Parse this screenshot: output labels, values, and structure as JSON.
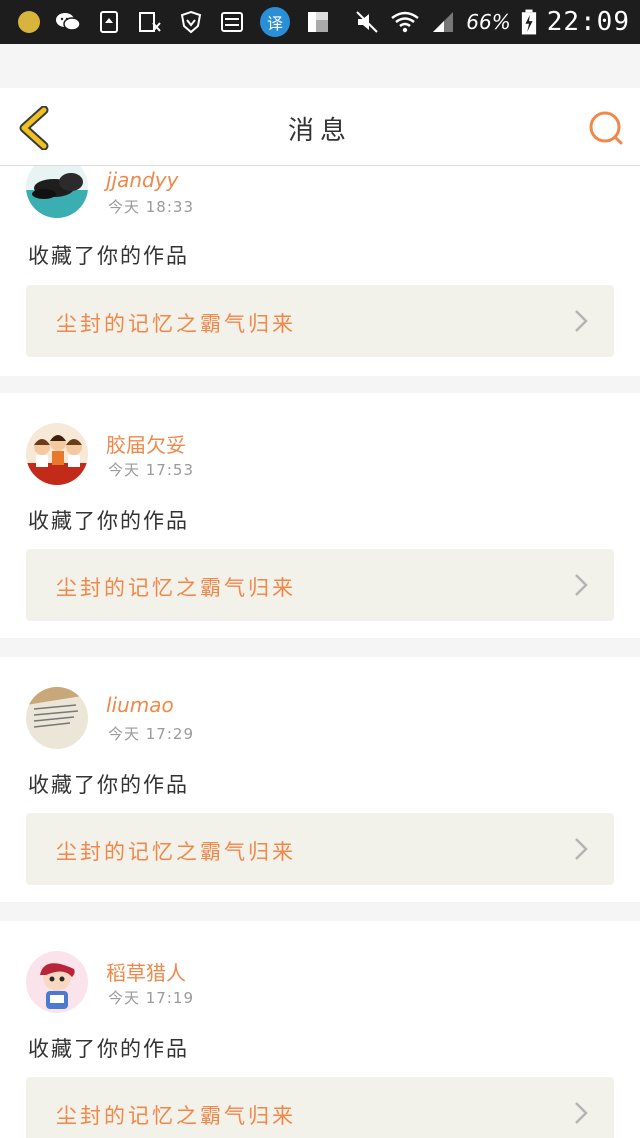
{
  "status_bar": {
    "battery": "66%",
    "time": "22:09",
    "translate_badge": "译"
  },
  "header": {
    "title": "消息"
  },
  "messages": [
    {
      "user": "jjandyy",
      "time": "今天 18:33",
      "action": "收藏了你的作品",
      "work": "尘封的记忆之霸气归来"
    },
    {
      "user": "胶届欠妥",
      "time": "今天 17:53",
      "action": "收藏了你的作品",
      "work": "尘封的记忆之霸气归来"
    },
    {
      "user": "liumao",
      "time": "今天 17:29",
      "action": "收藏了你的作品",
      "work": "尘封的记忆之霸气归来"
    },
    {
      "user": "稻草猎人",
      "time": "今天 17:19",
      "action": "收藏了你的作品",
      "work": "尘封的记忆之霸气归来"
    }
  ],
  "colors": {
    "accent": "#f0884a",
    "back_icon": "#f0c020",
    "card_bg": "#f2f1ea"
  }
}
